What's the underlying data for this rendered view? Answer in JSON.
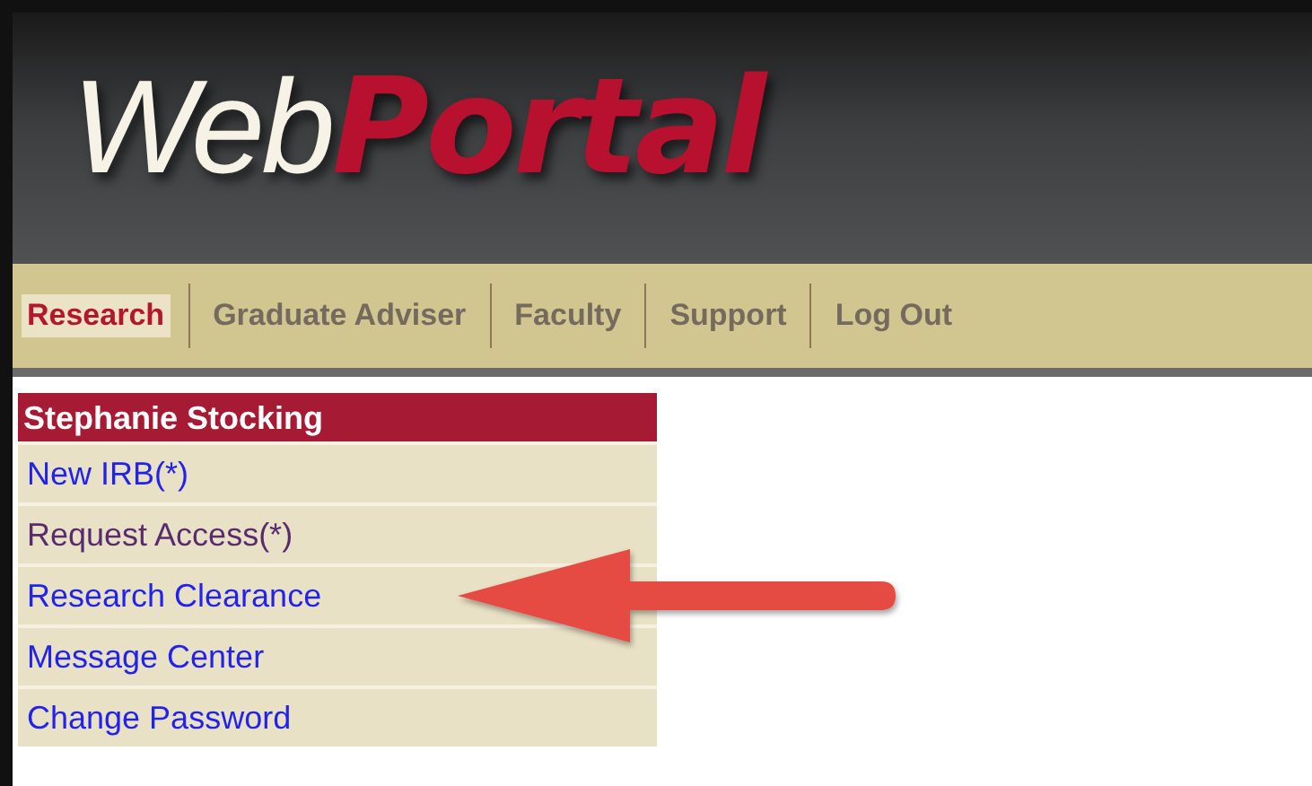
{
  "logo": {
    "light": "Web",
    "bold": "Portal"
  },
  "nav": [
    {
      "label": "Research",
      "selected": true
    },
    {
      "label": "Graduate Adviser",
      "selected": false
    },
    {
      "label": "Faculty",
      "selected": false
    },
    {
      "label": "Support",
      "selected": false
    },
    {
      "label": "Log Out",
      "selected": false
    }
  ],
  "menu": {
    "title": "Stephanie Stocking",
    "items": [
      {
        "label": "New IRB(*)",
        "visited": false,
        "arrow": false
      },
      {
        "label": "Request Access(*)",
        "visited": true,
        "arrow": false
      },
      {
        "label": "Research Clearance",
        "visited": false,
        "arrow": true
      },
      {
        "label": "Message Center",
        "visited": false,
        "arrow": false
      },
      {
        "label": "Change Password",
        "visited": false,
        "arrow": false
      }
    ]
  }
}
